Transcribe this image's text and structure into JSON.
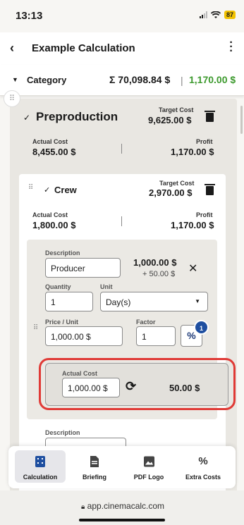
{
  "status": {
    "time": "13:13",
    "battery": "87"
  },
  "header": {
    "title": "Example Calculation"
  },
  "category": {
    "label": "Category",
    "sum": "Σ 70,098.84 $",
    "separator": "|",
    "profit": "1,170.00 $"
  },
  "preproduction": {
    "title": "Preproduction",
    "target_cost_label": "Target Cost",
    "target_cost": "9,625.00 $",
    "actual_cost_label": "Actual Cost",
    "actual_cost": "8,455.00 $",
    "profit_label": "Profit",
    "profit": "1,170.00 $"
  },
  "crew": {
    "title": "Crew",
    "target_cost_label": "Target Cost",
    "target_cost": "2,970.00 $",
    "actual_cost_label": "Actual Cost",
    "actual_cost": "1,800.00 $",
    "profit_label": "Profit",
    "profit": "1,170.00 $"
  },
  "item": {
    "description_label": "Description",
    "description_value": "Producer",
    "total": "1,000.00 $",
    "delta": "+ 50.00 $",
    "quantity_label": "Quantity",
    "quantity_value": "1",
    "unit_label": "Unit",
    "unit_value": "Day(s)",
    "price_label": "Price / Unit",
    "price_value": "1,000.00 $",
    "factor_label": "Factor",
    "factor_value": "1",
    "percent_symbol": "%",
    "percent_badge": "1",
    "actual_cost_label": "Actual Cost",
    "actual_cost_value": "1,000.00 $",
    "actual_profit": "50.00 $"
  },
  "next_item": {
    "description_label": "Description"
  },
  "nav": {
    "items": [
      {
        "label": "Calculation",
        "icon": "calculator-icon"
      },
      {
        "label": "Briefing",
        "icon": "document-icon"
      },
      {
        "label": "PDF Logo",
        "icon": "image-icon"
      },
      {
        "label": "Extra Costs",
        "icon": "percent-icon"
      }
    ]
  },
  "browser": {
    "url": "app.cinemacalc.com"
  },
  "colors": {
    "profit_green": "#3d9a2e",
    "highlight_red": "#e03a36",
    "accent_blue": "#1f4fa0"
  }
}
